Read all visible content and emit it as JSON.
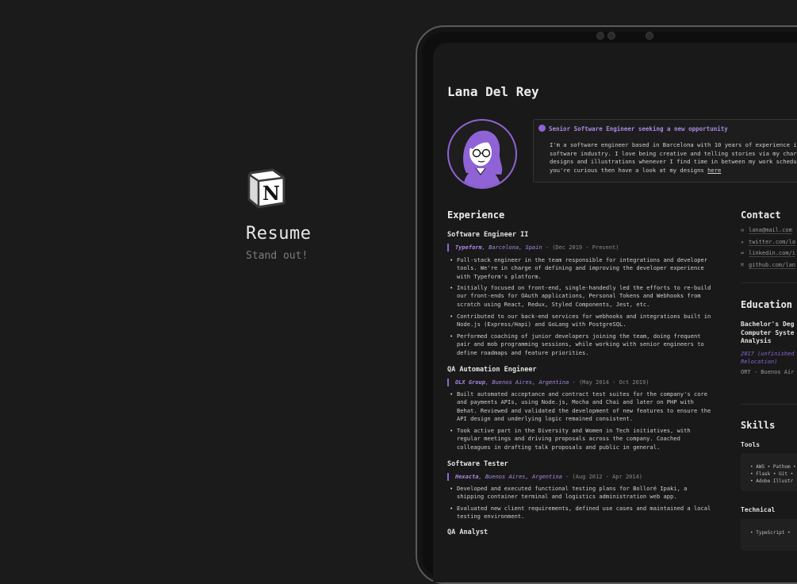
{
  "brand": {
    "title": "Resume",
    "subtitle": "Stand out!",
    "logo_icon": "notion-logo-icon"
  },
  "page": {
    "name": "Lana Del Rey"
  },
  "callout": {
    "icon": "person-icon",
    "headline": "Senior Software Engineer seeking a new opportunity",
    "lines": [
      "I'm a software engineer based in Barcelona with 10 years of experience in",
      "software industry. I love being creative and telling stories via my char",
      "designs and illustrations whenever I find time in between my work schedu",
      "you're curious then have a look at my designs "
    ],
    "link_text": "here"
  },
  "experience": {
    "heading": "Experience",
    "jobs": [
      {
        "title": "Software Engineer II",
        "company": "Typeform",
        "location": ", Barcelona, Spain",
        "dates": " - (Dec 2019 - Present)",
        "bullets": [
          [
            "Full-stack engineer in the team responsible for integrations and developer",
            "tools. We're in charge of defining and improving the developer experience",
            "with Typeform's platform."
          ],
          [
            "Initially focused on front-end, single-handedly led the efforts to re-build",
            "our front-ends for OAuth applications, Personal Tokens and Webhooks from",
            "scratch using React, Redux, Styled Components, Jest, etc."
          ],
          [
            "Contributed to our back-end services for webhooks and integrations built in",
            "Node.js (Express/Hapi) and GoLang with PostgreSQL."
          ],
          [
            "Performed coaching of junior developers joining the team, doing frequent",
            "pair and mob programming sessions, while working with senior engineers to",
            "define roadmaps and feature priorities."
          ]
        ]
      },
      {
        "title": "QA Automation Engineer",
        "company": "OLX Group",
        "location": ", Buenos Aires, Argentina",
        "dates": " - (May 2014 - Oct 2019)",
        "bullets": [
          [
            "Built automated acceptance and contract test suites for the company's core",
            "and payments APIs, using Node.js, Mocha and Chai and later on PHP with",
            "Behat. Reviewed and validated the development of new features to ensure the",
            "API design and underlying logic remained consistent."
          ],
          [
            "Took active part in the Diversity and Women in Tech initiatives, with",
            "regular meetings and driving proposals across the company. Coached",
            "colleagues in drafting talk proposals and public in general."
          ]
        ]
      },
      {
        "title": "Software Tester",
        "company": "Hexacta",
        "location": ", Buenos Aires, Argentina",
        "dates": " - (Aug 2012 - Apr 2014)",
        "bullets": [
          [
            "Developed and executed functional testing plans for Bolloré Ipaki, a",
            "shipping container terminal and logistics administration web app."
          ],
          [
            "Evaluated new client requirements, defined use cases and maintained a local",
            "testing environment."
          ]
        ]
      },
      {
        "title": "QA Analyst"
      }
    ]
  },
  "contact": {
    "heading": "Contact",
    "items": [
      {
        "icon": "mail-icon",
        "glyph": "✉",
        "text": "lana@mail.com"
      },
      {
        "icon": "twitter-icon",
        "glyph": "✦",
        "text": "twitter.com/la"
      },
      {
        "icon": "link-icon",
        "glyph": "∞",
        "text": "linkedin.com/i"
      },
      {
        "icon": "github-icon",
        "glyph": "⌘",
        "text": "github.com/lan"
      }
    ]
  },
  "education": {
    "heading": "Education",
    "degree_lines": [
      "Bachelor's Deg",
      "Computer Syste",
      "Analysis"
    ],
    "year_lines": [
      "2017 (unfinished",
      "Relocation)"
    ],
    "school": "ORT - Buenos Air"
  },
  "skills": {
    "heading": "Skills",
    "tools": {
      "heading": "Tools",
      "lines": [
        "• AWS • Pathom •",
        "• Flask • Git •",
        "• Adobe Illustr"
      ]
    },
    "technical": {
      "heading": "Technical",
      "lines": [
        "• TypeScript •"
      ]
    }
  },
  "colors": {
    "accent": "#8f63d6",
    "background": "#1b1b1b",
    "screen": "#191919"
  }
}
